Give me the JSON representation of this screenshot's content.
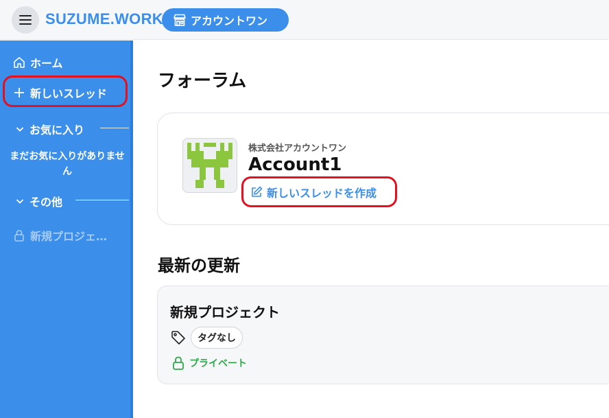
{
  "header": {
    "brand": "SUZUME.WORK",
    "account_pill": "アカウントワン"
  },
  "sidebar": {
    "home": "ホーム",
    "new_thread": "新しいスレッド",
    "favorites_section": "お気に入り",
    "favorites_empty": "まだお気に入りがありません",
    "other_section": "その他",
    "project_item": "新規プロジェ…"
  },
  "main": {
    "title": "フォーラム",
    "forum": {
      "company": "株式会社アカウントワン",
      "account_name": "Account1",
      "new_thread_link": "新しいスレッドを作成"
    },
    "recent_title": "最新の更新",
    "update": {
      "project_title": "新規プロジェクト",
      "tag": "タグなし",
      "privacy": "プライベート"
    }
  },
  "colors": {
    "accent": "#3b8eea",
    "annotation": "#e3101f",
    "private": "#2ea84a",
    "logo_green": "#8cc63f"
  }
}
